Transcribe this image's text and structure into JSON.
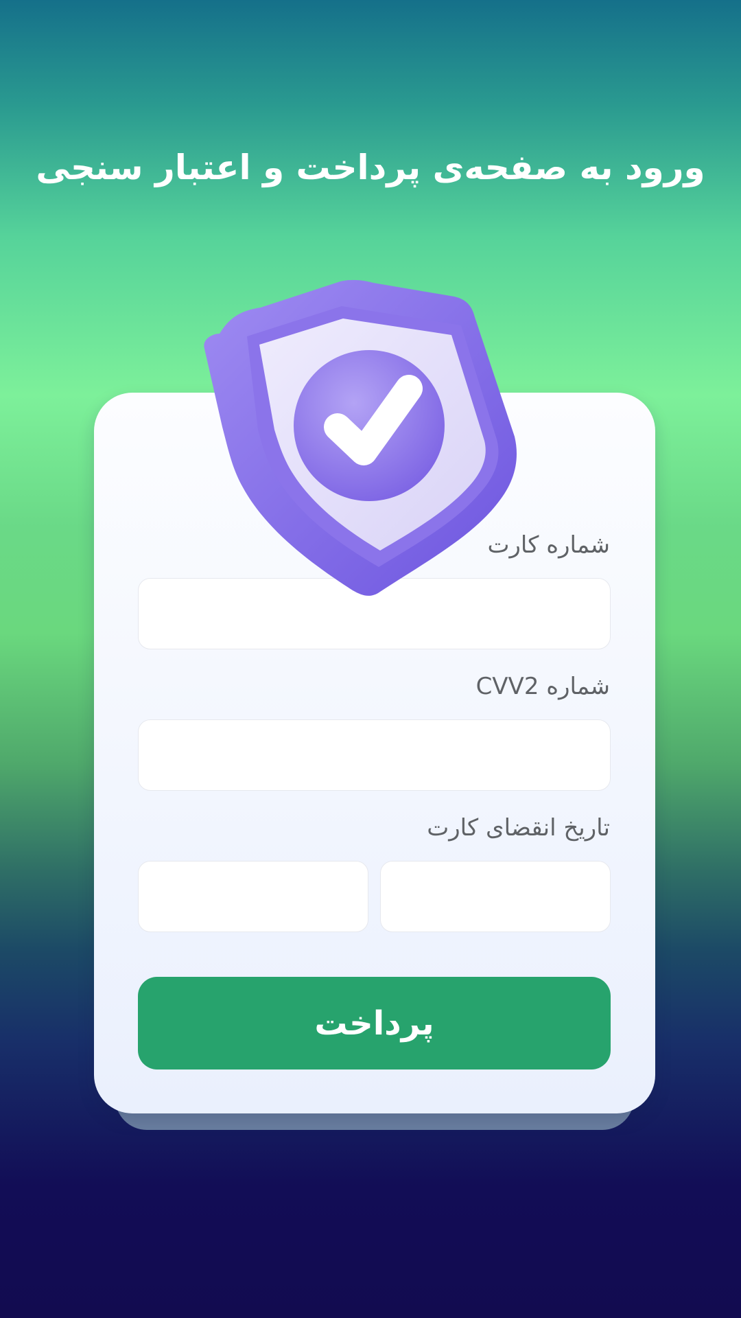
{
  "header": {
    "title": "ورود به صفحه‌ی پرداخت و اعتبار سنجی"
  },
  "hero": {
    "icon": "shield-check-icon",
    "colors": {
      "shield_dark": "#7b63e6",
      "shield_light": "#e2ddfa",
      "check": "#ffffff"
    }
  },
  "form": {
    "card_number": {
      "label": "شماره کارت",
      "value": "",
      "placeholder": ""
    },
    "cvv2": {
      "label": "شماره CVV2",
      "value": "",
      "placeholder": ""
    },
    "expiry": {
      "label": "تاریخ انقضای کارت",
      "month_value": "",
      "year_value": "",
      "month_placeholder": "",
      "year_placeholder": ""
    },
    "submit_label": "پرداخت"
  },
  "colors": {
    "accent": "#27a36d",
    "label_text": "#5f6266",
    "card_background": "#f4f7fe"
  }
}
